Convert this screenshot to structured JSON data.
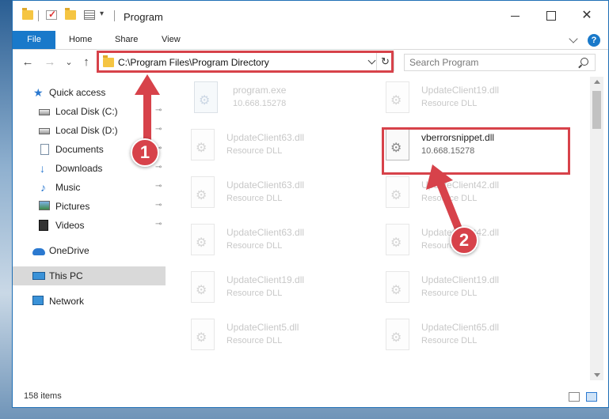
{
  "window": {
    "title": "Program",
    "minimize_label": "",
    "maximize_label": "",
    "close_label": "✕"
  },
  "ribbon": {
    "tabs": [
      {
        "label": "File"
      },
      {
        "label": "Home"
      },
      {
        "label": "Share"
      },
      {
        "label": "View"
      }
    ],
    "help_label": "?"
  },
  "nav": {
    "back_label": "←",
    "forward_label": "→",
    "recent_label": "⌄",
    "up_label": "↑",
    "address": "C:\\Program Files\\Program Directory",
    "refresh_label": "↻",
    "search_placeholder": "Search Program"
  },
  "sidebar": {
    "items": [
      {
        "label": "Quick access",
        "icon": "star-icon"
      },
      {
        "label": "Local Disk (C:)",
        "icon": "disk-icon",
        "pinned": true
      },
      {
        "label": "Local Disk (D:)",
        "icon": "disk-icon",
        "pinned": true
      },
      {
        "label": "Documents",
        "icon": "documents-icon",
        "pinned": true
      },
      {
        "label": "Downloads",
        "icon": "download-icon",
        "pinned": true
      },
      {
        "label": "Music",
        "icon": "music-icon",
        "pinned": true
      },
      {
        "label": "Pictures",
        "icon": "pictures-icon",
        "pinned": true
      },
      {
        "label": "Videos",
        "icon": "videos-icon",
        "pinned": true
      },
      {
        "label": "OneDrive",
        "icon": "cloud-icon"
      },
      {
        "label": "This PC",
        "icon": "computer-icon",
        "selected": true
      },
      {
        "label": "Network",
        "icon": "network-icon"
      }
    ],
    "pin_glyph": "📌"
  },
  "files": [
    {
      "name": "program.exe",
      "sub": "10.668.15278",
      "type": "exe"
    },
    {
      "name": "UpdateClient19.dll",
      "sub": "Resource DLL",
      "type": "dll"
    },
    {
      "name": "UpdateClient63.dll",
      "sub": "Resource DLL",
      "type": "dll"
    },
    {
      "name": "vberrorsnippet.dll",
      "sub": "10.668.15278",
      "type": "dll",
      "highlighted": true
    },
    {
      "name": "UpdateClient63.dll",
      "sub": "Resource DLL",
      "type": "dll"
    },
    {
      "name": "UpdateClient42.dll",
      "sub": "Resource DLL",
      "type": "dll"
    },
    {
      "name": "UpdateClient63.dll",
      "sub": "Resource DLL",
      "type": "dll"
    },
    {
      "name": "UpdateClient42.dll",
      "sub": "Resource DLL",
      "type": "dll"
    },
    {
      "name": "UpdateClient19.dll",
      "sub": "Resource DLL",
      "type": "dll"
    },
    {
      "name": "UpdateClient19.dll",
      "sub": "Resource DLL",
      "type": "dll"
    },
    {
      "name": "UpdateClient5.dll",
      "sub": "Resource DLL",
      "type": "dll"
    },
    {
      "name": "UpdateClient65.dll",
      "sub": "Resource DLL",
      "type": "dll"
    }
  ],
  "status": {
    "item_count": "158 items"
  },
  "callouts": [
    {
      "label": "1"
    },
    {
      "label": "2"
    }
  ],
  "colors": {
    "accent": "#1979ca",
    "highlight": "#d7424a",
    "selected_bg": "#d9d9d9"
  }
}
